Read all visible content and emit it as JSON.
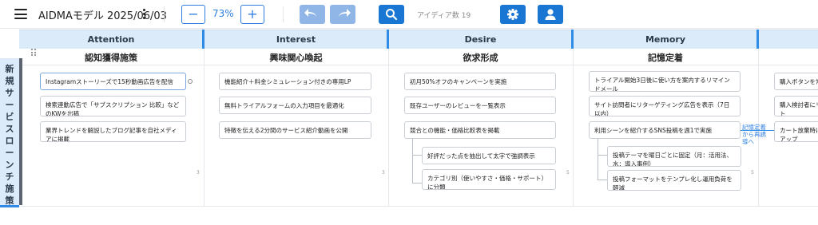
{
  "toolbar": {
    "title": "AIDMAモデル 2025/06/03",
    "zoom_out_label": "−",
    "zoom_value": "73%",
    "zoom_in_label": "+",
    "idea_count": "アイディア数 19",
    "icons": [
      "menu-icon",
      "more-vert-icon",
      "undo-icon",
      "redo-icon",
      "search-icon",
      "settings-icon",
      "user-icon"
    ]
  },
  "board": {
    "row_label": [
      "新",
      "規",
      "サ",
      "ー",
      "ビ",
      "ス",
      "ロ",
      "ー",
      "ン",
      "チ",
      "施",
      "策"
    ],
    "columns": [
      {
        "header": "Attention",
        "stage": "認知獲得施策",
        "cell_number": "3"
      },
      {
        "header": "Interest",
        "stage": "興味関心喚起",
        "cell_number": "3"
      },
      {
        "header": "Desire",
        "stage": "欲求形成",
        "cell_number": "5"
      },
      {
        "header": "Memory",
        "stage": "記憶定着",
        "cell_number": "5"
      },
      {
        "header": "",
        "stage": "",
        "cell_number": ""
      }
    ],
    "cards": {
      "attention": [
        "Instagramストーリーズで15秒動画広告を配信",
        "検索連動広告で「サブスクリプション 比較」などのKWを出稿",
        "業界トレンドを解説したブログ記事を自社メディアに掲載"
      ],
      "interest": [
        "機能紹介＋料金シミュレーション付きの専用LP",
        "無料トライアルフォームの入力項目を最適化",
        "特徴を伝える2分間のサービス紹介動画を公開"
      ],
      "desire": [
        "初月50%オフのキャンペーンを実施",
        "既存ユーザーのレビューを一覧表示",
        "競合との機能・価格比較表を掲載",
        "好評だった点を抽出して太字で強調表示",
        "カテゴリ別（使いやすさ・価格・サポート）に分類"
      ],
      "memory": [
        "トライアル開始3日後に使い方を案内するリマインドメール",
        "サイト訪問者にリターゲティング広告を表示（7日以内）",
        "利用シーンを紹介するSNS投稿を週1で実施",
        "投稿テーマを曜日ごとに固定（月：活用法、水：導入事例）",
        "投稿フォーマットをテンプレ化し運用負荷を軽減"
      ],
      "action": [
        "購入ボタンを常",
        "購入検討者にリト",
        "カート放棄時にアップ"
      ]
    },
    "connector_label": "記憶定着から再誘導へ"
  }
}
